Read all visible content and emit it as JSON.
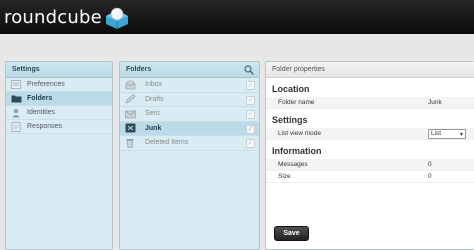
{
  "app": {
    "logo_text": "roundcube"
  },
  "settings": {
    "title": "Settings",
    "items": [
      {
        "label": "Preferences",
        "icon": "preferences-icon",
        "selected": false
      },
      {
        "label": "Folders",
        "icon": "folders-icon",
        "selected": true
      },
      {
        "label": "Identities",
        "icon": "identities-icon",
        "selected": false
      },
      {
        "label": "Responses",
        "icon": "responses-icon",
        "selected": false
      }
    ]
  },
  "folders": {
    "title": "Folders",
    "search_icon": "search-icon",
    "items": [
      {
        "label": "Inbox",
        "icon": "inbox-icon",
        "selected": false
      },
      {
        "label": "Drafts",
        "icon": "drafts-icon",
        "selected": false
      },
      {
        "label": "Sent",
        "icon": "sent-icon",
        "selected": false
      },
      {
        "label": "Junk",
        "icon": "junk-icon",
        "selected": true
      },
      {
        "label": "Deleted Items",
        "icon": "trash-icon",
        "selected": false
      }
    ]
  },
  "properties": {
    "title": "Folder properties",
    "location": {
      "heading": "Location",
      "folder_name_label": "Folder name",
      "folder_name_value": "Junk"
    },
    "settings": {
      "heading": "Settings",
      "list_view_label": "List view mode",
      "list_view_value": "List"
    },
    "information": {
      "heading": "Information",
      "messages_label": "Messages",
      "messages_value": "0",
      "size_label": "Size",
      "size_value": "0"
    },
    "save_label": "Save"
  },
  "colors": {
    "topbar": "#0b0b0b",
    "panel_header": "#b9d9e7",
    "selected_row": "#bcdbe9",
    "panel_bg": "#d9ecf4"
  }
}
